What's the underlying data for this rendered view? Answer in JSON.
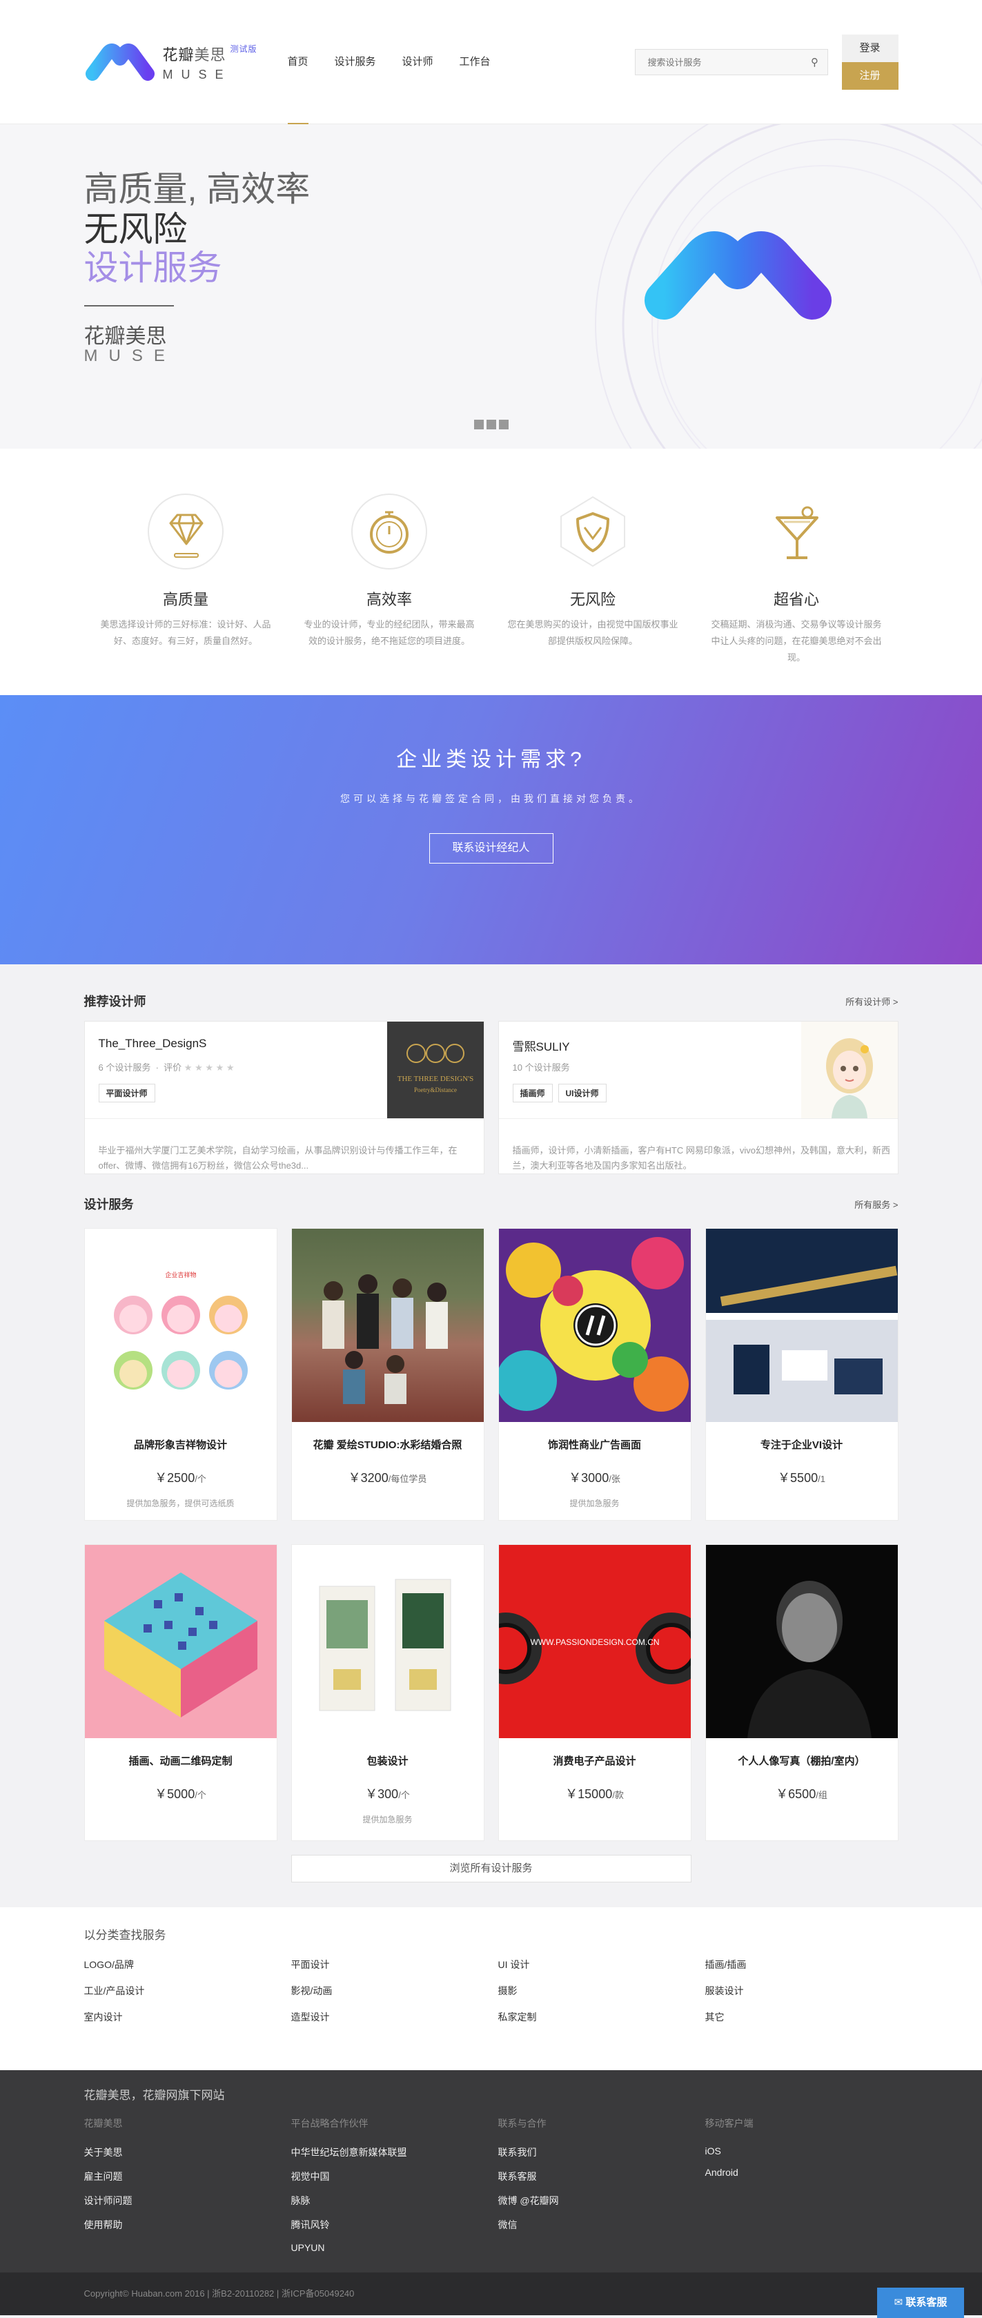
{
  "header": {
    "logo_cn_main": "花瓣",
    "logo_cn_sub": "美思",
    "logo_beta": "测试版",
    "logo_en": "MUSE",
    "nav": [
      {
        "label": "首页",
        "active": true
      },
      {
        "label": "设计服务",
        "active": false
      },
      {
        "label": "设计师",
        "active": false
      },
      {
        "label": "工作台",
        "active": false
      }
    ],
    "search_placeholder": "搜索设计服务",
    "login_label": "登录",
    "register_label": "注册"
  },
  "hero": {
    "line1": "高质量, 高效率",
    "line2": "无风险",
    "line3": "设计服务",
    "brand_cn": "花瓣美思",
    "brand_en": "MUSE",
    "slides_count": 3
  },
  "features": [
    {
      "icon": "diamond-icon",
      "title": "高质量",
      "text": "美思选择设计师的三好标准：设计好、人品好、态度好。有三好，质量自然好。"
    },
    {
      "icon": "stopwatch-icon",
      "title": "高效率",
      "text": "专业的设计师，专业的经纪团队，带来最高效的设计服务，绝不拖延您的项目进度。"
    },
    {
      "icon": "shield-icon",
      "title": "无风险",
      "text": "您在美思购买的设计，由视觉中国版权事业部提供版权风险保障。"
    },
    {
      "icon": "cocktail-icon",
      "title": "超省心",
      "text": "交稿延期、消极沟通、交易争议等设计服务中让人头疼的问题，在花瓣美思绝对不会出现。"
    }
  ],
  "banner": {
    "title": "企业类设计需求?",
    "subtitle": "您可以选择与花瓣签定合同，由我们直接对您负责。",
    "button": "联系设计经纪人"
  },
  "designers": {
    "title": "推荐设计师",
    "more": "所有设计师 >",
    "items": [
      {
        "name": "The_Three_DesignS",
        "count": "6",
        "count_label": "个设计服务",
        "rating_label": "评价",
        "stars": "★ ★ ★ ★ ★",
        "tags": [
          "平面设计师"
        ],
        "desc": "毕业于福州大学厦门工艺美术学院，自幼学习绘画，从事品牌识别设计与传播工作三年，在offer、微博、微信拥有16万粉丝，微信公众号the3d...",
        "avatar_text1": "THE THREE DESIGN'S",
        "avatar_text2": "Poetry&Distance"
      },
      {
        "name": "雪熙SULIY",
        "count": "10",
        "count_label": "个设计服务",
        "tags": [
          "插画师",
          "UI设计师"
        ],
        "desc": "插画师，设计师，小清新插画，客户有HTC 网易印象派，vivo幻想神州，及韩国，意大利，新西兰，澳大利亚等各地及国内多家知名出版社。"
      }
    ]
  },
  "services": {
    "title": "设计服务",
    "more": "所有服务 >",
    "browse_all": "浏览所有设计服务",
    "items": [
      {
        "title": "品牌形象吉祥物设计",
        "price": "￥2500",
        "unit": "/个",
        "note": "提供加急服务，提供可选纸质"
      },
      {
        "title": "花瓣 爱绘STUDIO:水彩结婚合照",
        "price": "￥3200",
        "unit": "/每位学员",
        "note": ""
      },
      {
        "title": "饰润性商业广告画面",
        "price": "￥3000",
        "unit": "/张",
        "note": "提供加急服务"
      },
      {
        "title": "专注于企业VI设计",
        "price": "￥5500",
        "unit": "/1",
        "note": ""
      },
      {
        "title": "插画、动画二维码定制",
        "price": "￥5000",
        "unit": "/个",
        "note": ""
      },
      {
        "title": "包装设计",
        "price": "￥300",
        "unit": "/个",
        "note": "提供加急服务"
      },
      {
        "title": "消费电子产品设计",
        "price": "￥15000",
        "unit": "/款",
        "note": ""
      },
      {
        "title": "个人人像写真（棚拍/室内）",
        "price": "￥6500",
        "unit": "/组",
        "note": ""
      }
    ],
    "passion_text": "WWW.PASSIONDESIGN.COM.CN",
    "card1_caption": "企业吉祥物"
  },
  "categories": {
    "title": "以分类查找服务",
    "items": [
      "LOGO/品牌",
      "平面设计",
      "UI 设计",
      "插画/插画",
      "工业/产品设计",
      "影视/动画",
      "摄影",
      "服装设计",
      "室内设计",
      "造型设计",
      "私家定制",
      "其它"
    ]
  },
  "footer": {
    "title": "花瓣美思，花瓣网旗下网站",
    "cols": [
      {
        "head": "花瓣美思",
        "links": [
          "关于美思",
          "雇主问题",
          "设计师问题",
          "使用帮助"
        ]
      },
      {
        "head": "平台战略合作伙伴",
        "links": [
          "中华世纪坛创意新媒体联盟",
          "视觉中国",
          "脉脉",
          "腾讯风铃",
          "UPYUN"
        ]
      },
      {
        "head": "联系与合作",
        "links": [
          "联系我们",
          "联系客服",
          "微博 @花瓣网",
          "微信"
        ]
      },
      {
        "head": "移动客户端",
        "links": [
          "iOS",
          "Android"
        ]
      }
    ],
    "copyright": "Copyright© Huaban.com 2016 | 浙B2-20110282 | 浙ICP备05049240",
    "contact_button": "联系客服"
  }
}
